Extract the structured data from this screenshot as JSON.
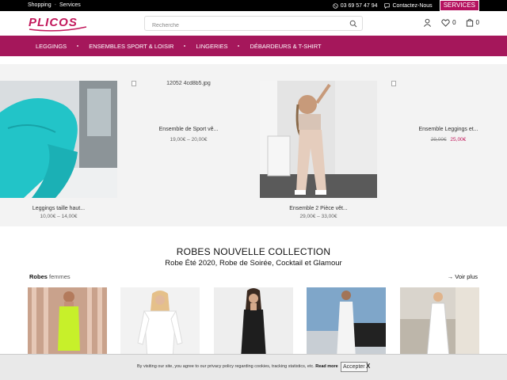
{
  "topbar": {
    "links": [
      "Shopping",
      "Services"
    ],
    "separator": "-",
    "phone": "03 69 57 47 94",
    "contact": "Contactez-Nous",
    "services_button": "SERVICES"
  },
  "header": {
    "logo_text": "PLICOS",
    "search_placeholder": "Recherche",
    "wishlist_count": "0",
    "cart_count": "0"
  },
  "nav": {
    "items": [
      "LEGGINGS",
      "ENSEMBLES SPORT & LOISIR",
      "LINGERIES",
      "DÉBARDEURS & T-SHIRT"
    ]
  },
  "products": [
    {
      "name": "Leggings taille haut...",
      "price_old": "",
      "price": "10,00€ – 14,00€",
      "image_alt": ""
    },
    {
      "name": "Ensemble de Sport vê...",
      "price_old": "",
      "price": "19,00€ – 20,00€",
      "image_alt": "12052 4cd8b5.jpg"
    },
    {
      "name": "Ensemble 2 Pièce vêt...",
      "price_old": "",
      "price": "29,00€ – 33,00€",
      "image_alt": ""
    },
    {
      "name": "Ensemble Leggings et...",
      "price_old": "29,00€",
      "price": "25,00€",
      "image_alt": ""
    }
  ],
  "section": {
    "title": "ROBES NOUVELLE COLLECTION",
    "subtitle": "Robe Été 2020, Robe de Soirée, Cocktail et Glamour",
    "category_bold": "Robes",
    "category_rest": "femmes",
    "more_link": "→ Voir plus"
  },
  "cookie": {
    "message": "By visiting our site, you agree to our privacy policy regarding cookies, tracking statistics, etc.",
    "read_more": "Read more",
    "accept": "Accepter",
    "close": "X"
  },
  "colors": {
    "brand": "#a5175b",
    "accent": "#c2185b",
    "topbar": "#000000"
  }
}
